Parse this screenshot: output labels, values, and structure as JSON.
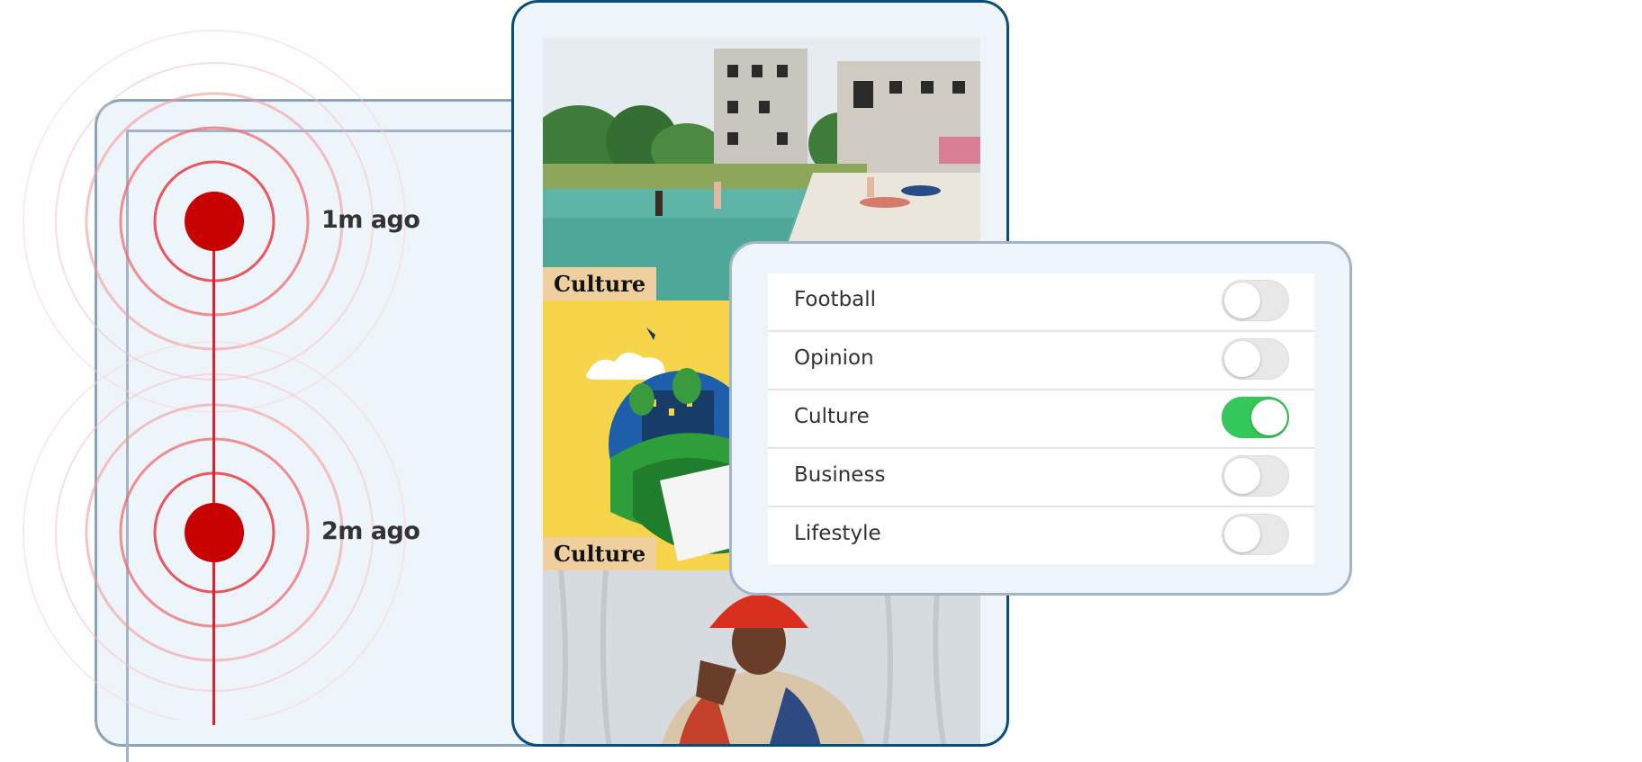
{
  "timeline": {
    "items": [
      {
        "time": "1m ago"
      },
      {
        "time": "2m ago"
      }
    ],
    "accent": "#c70000"
  },
  "feed": {
    "cards": [
      {
        "section": "Culture",
        "image": "lake-beach-ruins-photo"
      },
      {
        "section": "Culture",
        "image": "globe-illustration"
      },
      {
        "section": "",
        "image": "portrait-red-bucket-hat"
      }
    ],
    "badge_color": "#f0cf9e"
  },
  "settings": {
    "items": [
      {
        "label": "Football",
        "enabled": false
      },
      {
        "label": "Opinion",
        "enabled": false
      },
      {
        "label": "Culture",
        "enabled": true
      },
      {
        "label": "Business",
        "enabled": false
      },
      {
        "label": "Lifestyle",
        "enabled": false
      }
    ],
    "toggle_on_color": "#34c759"
  }
}
